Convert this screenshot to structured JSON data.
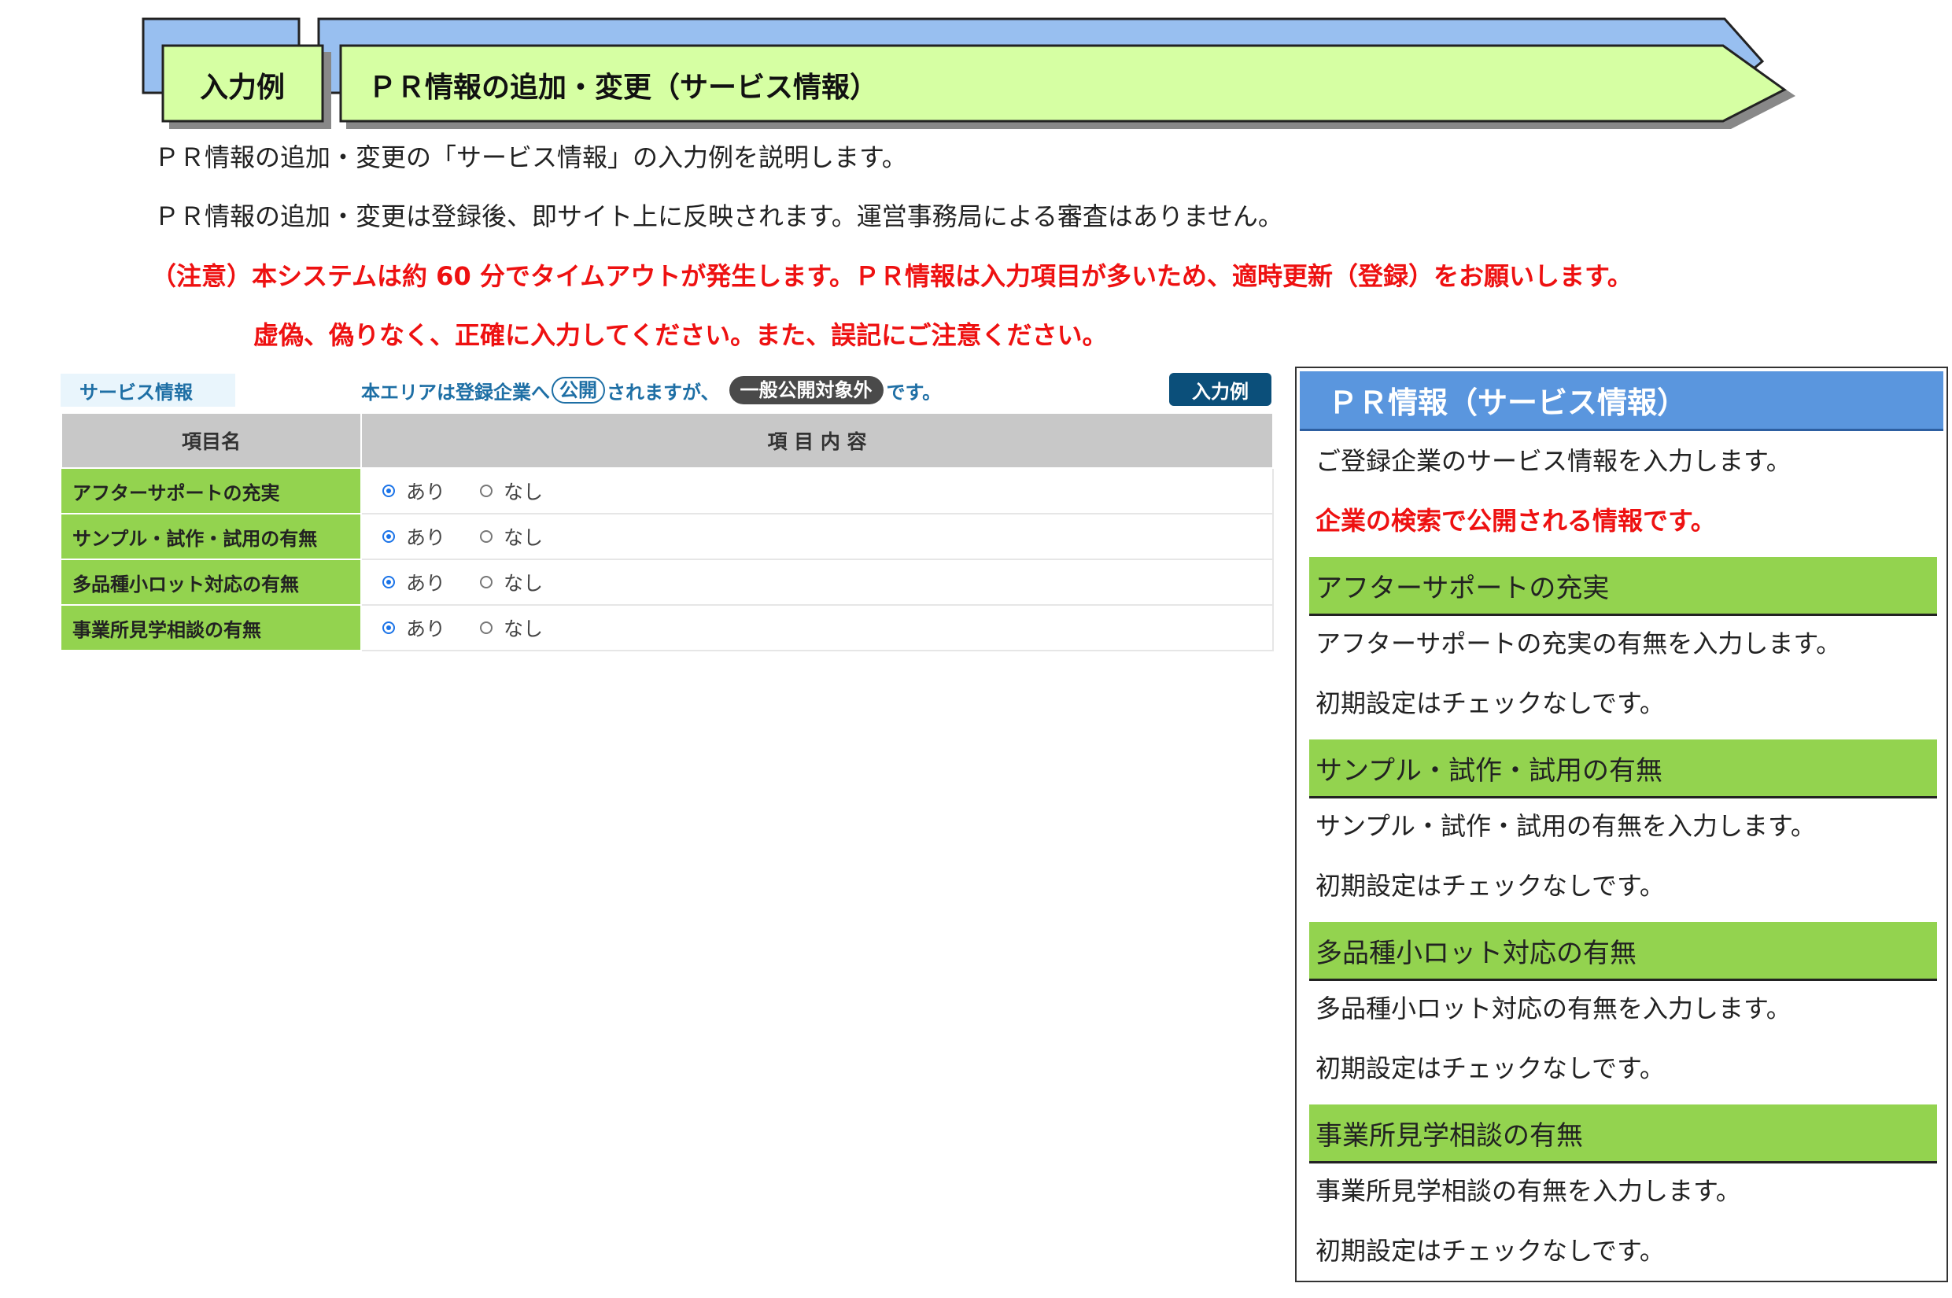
{
  "header": {
    "badge_label": "入力例",
    "title": "ＰＲ情報の追加・変更（サービス情報）"
  },
  "intro": {
    "line1": "ＰＲ情報の追加・変更の「サービス情報」の入力例を説明します。",
    "line2": "ＰＲ情報の追加・変更は登録後、即サイト上に反映されます。運営事務局による審査はありません。"
  },
  "notice": {
    "line1": "（注意）本システムは約 60 分でタイムアウトが発生します。ＰＲ情報は入力項目が多いため、適時更新（登録）をお願いします。",
    "line2": "虚偽、偽りなく、正確に入力してください。また、誤記にご注意ください。"
  },
  "form": {
    "section_tag": "サービス情報",
    "notice_prefix": "本エリアは登録企業へ",
    "notice_public": "公開",
    "notice_middle": "されますが、",
    "notice_excluded": "一般公開対象外",
    "notice_suffix": "です。",
    "example_button": "入力例",
    "columns": [
      "項目名",
      "項 目 内 容"
    ],
    "option_yes": "あり",
    "option_no": "なし",
    "rows": [
      {
        "name": "アフターサポートの充実",
        "selected": "yes"
      },
      {
        "name": "サンプル・試作・試用の有無",
        "selected": "yes"
      },
      {
        "name": "多品種小ロット対応の有無",
        "selected": "yes"
      },
      {
        "name": "事業所見学相談の有無",
        "selected": "yes"
      }
    ]
  },
  "panel": {
    "title": "ＰＲ情報（サービス情報）",
    "intro": "ご登録企業のサービス情報を入力します。",
    "intro_red": "企業の検索で公開される情報です。",
    "sections": [
      {
        "heading": "アフターサポートの充実",
        "desc": "アフターサポートの充実の有無を入力します。",
        "default": "初期設定はチェックなしです。"
      },
      {
        "heading": "サンプル・試作・試用の有無",
        "desc": "サンプル・試作・試用の有無を入力します。",
        "default": "初期設定はチェックなしです。"
      },
      {
        "heading": "多品種小ロット対応の有無",
        "desc": "多品種小ロット対応の有無を入力します。",
        "default": "初期設定はチェックなしです。"
      },
      {
        "heading": "事業所見学相談の有無",
        "desc": "事業所見学相談の有無を入力します。",
        "default": "初期設定はチェックなしです。"
      }
    ]
  }
}
